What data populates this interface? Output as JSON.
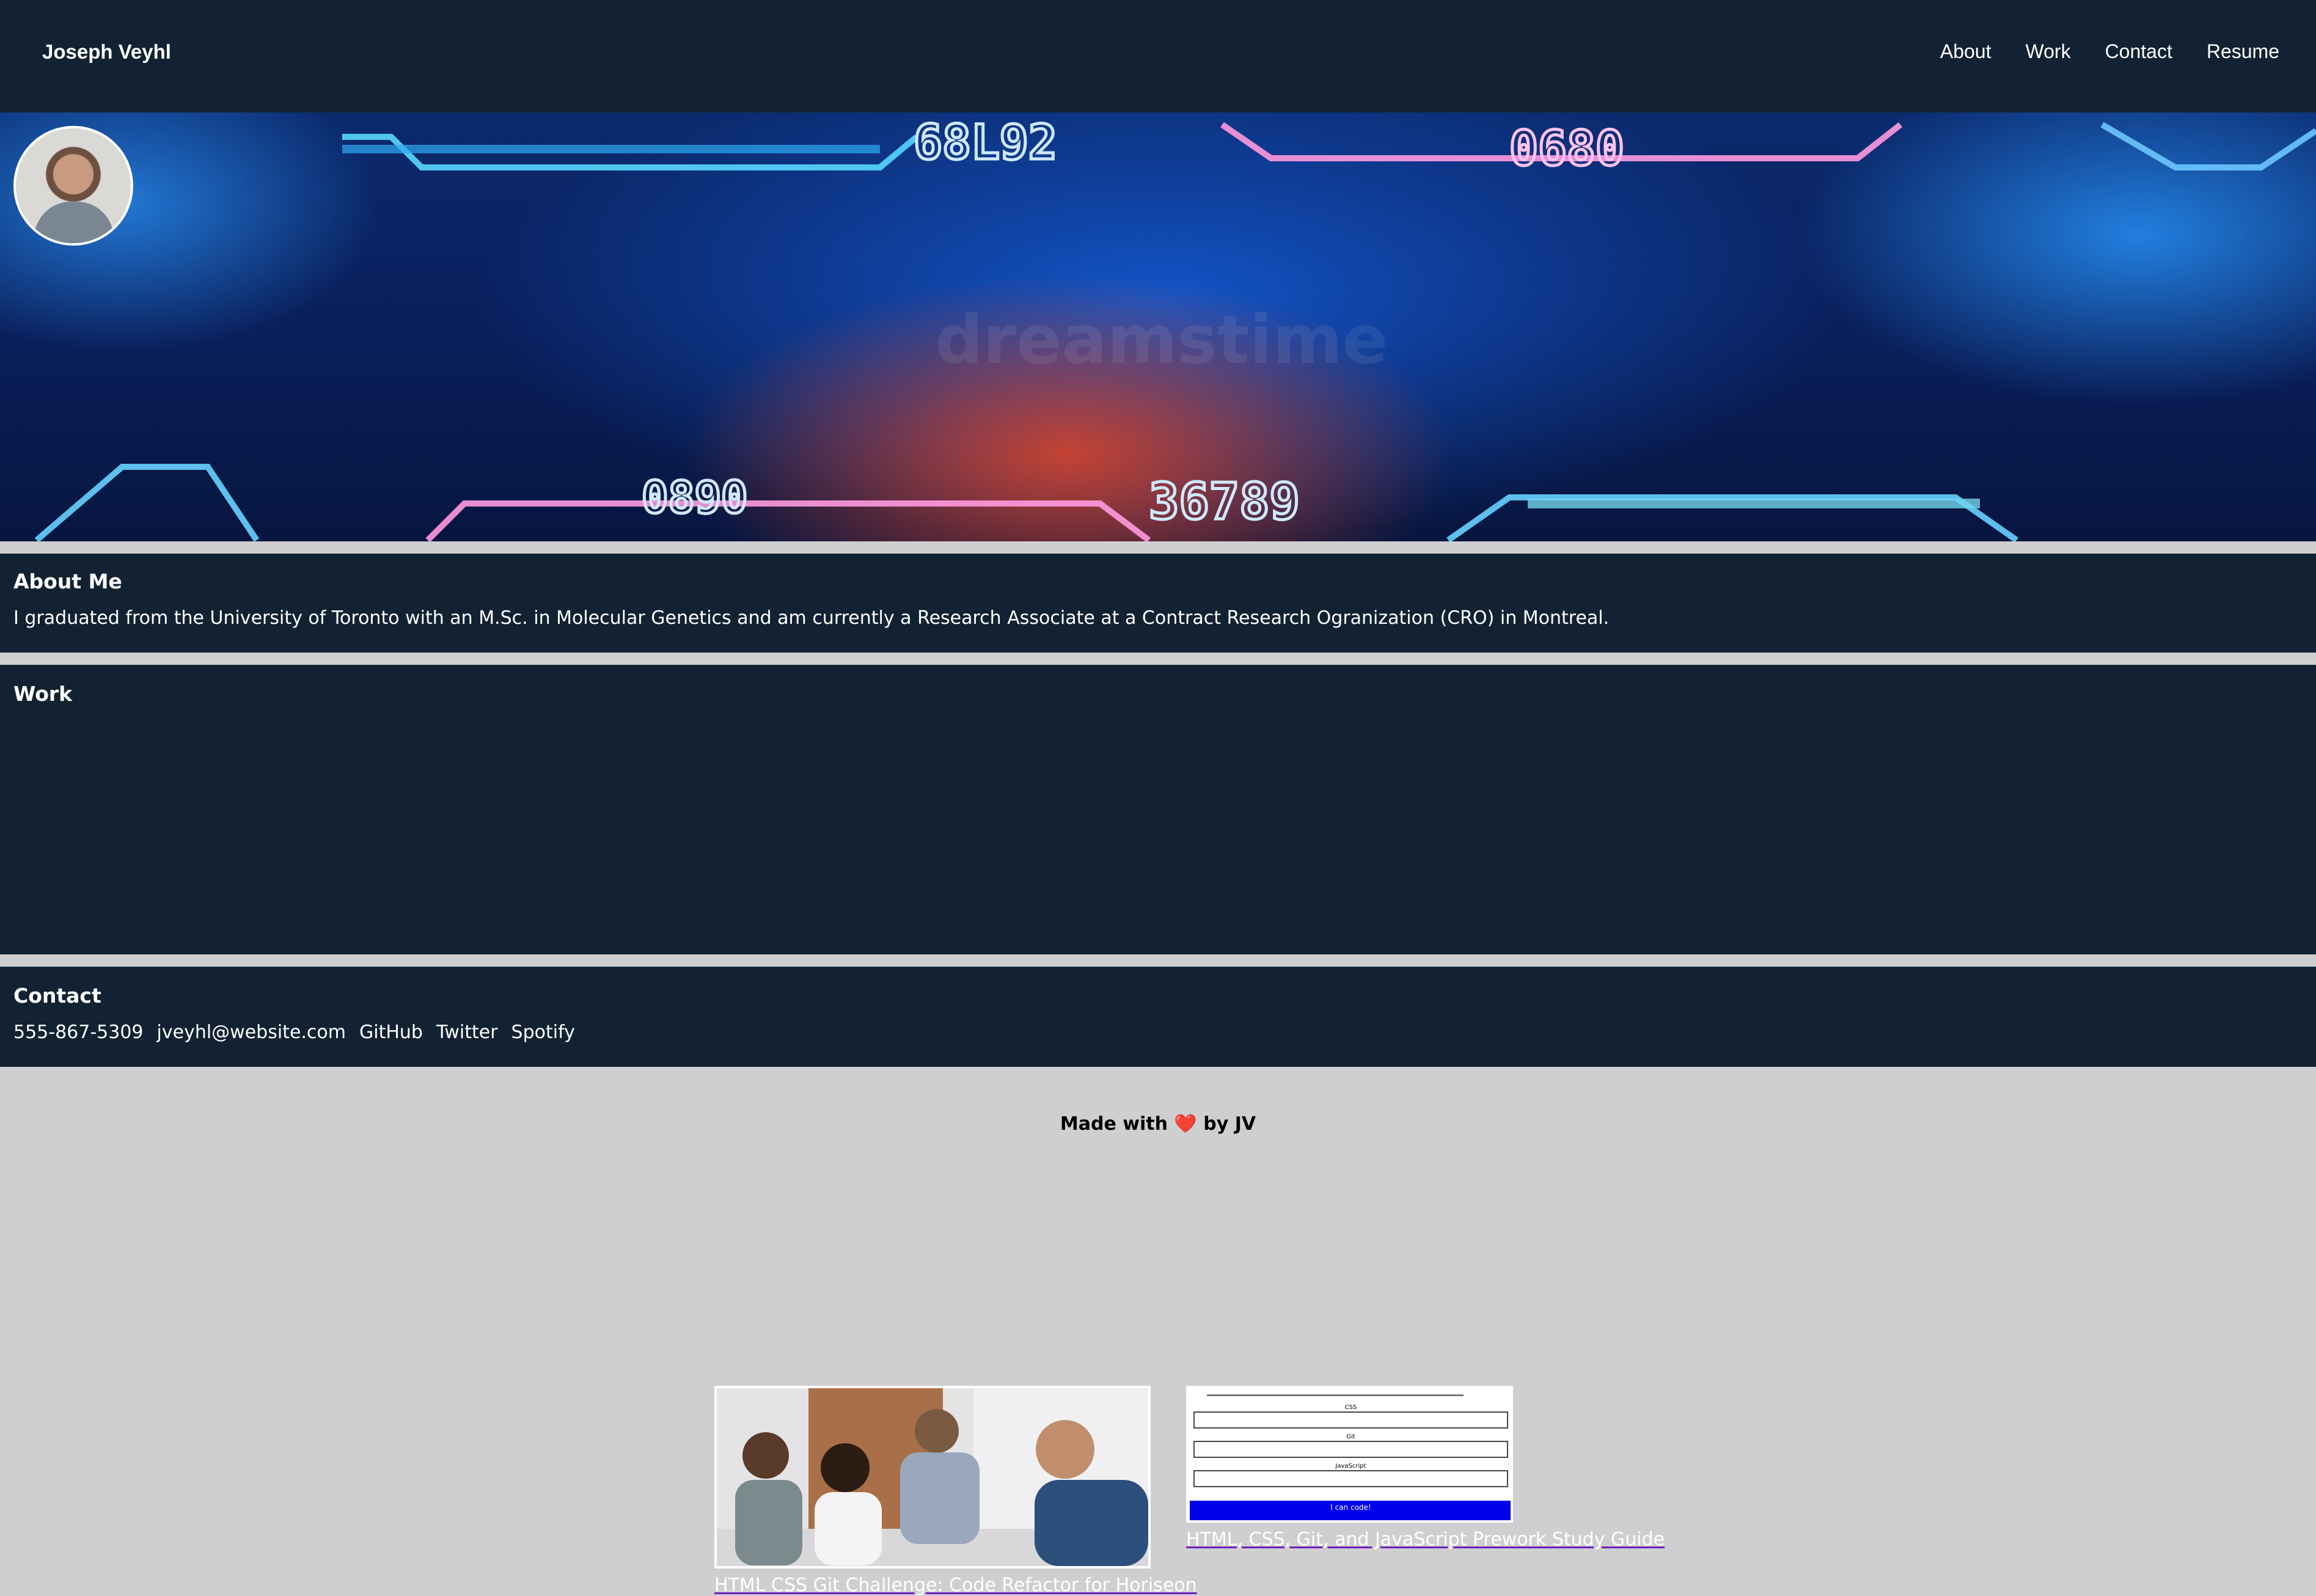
{
  "header": {
    "brand": "Joseph Veyhl",
    "nav": [
      "About",
      "Work",
      "Contact",
      "Resume"
    ]
  },
  "hero": {
    "watermark": "dreamstime",
    "digits": [
      "68L92",
      "0680",
      "0890",
      "36789"
    ]
  },
  "about": {
    "title": "About Me",
    "text": "I graduated from the University of Toronto with an M.Sc. in Molecular Genetics and am currently a Research Associate at a Contract Research Ogranization (CRO) in Montreal."
  },
  "work": {
    "title": "Work",
    "projects": [
      {
        "caption": "HTML CSS Git Challenge: Code Refactor for Horiseon"
      },
      {
        "caption": "HTML, CSS, Git, and JavaScript Prework Study Guide",
        "thumb_headings": [
          "CSS",
          "Git",
          "JavaScript"
        ],
        "thumb_footer": "I can code!"
      }
    ]
  },
  "contact": {
    "title": "Contact",
    "links": [
      "555-867-5309",
      "jveyhl@website.com",
      "GitHub",
      "Twitter",
      "Spotify"
    ]
  },
  "footer": {
    "pre": "Made with",
    "heart": "❤️",
    "post": "by JV"
  },
  "colors": {
    "dark": "#122232",
    "page_bg": "#cfcfd1",
    "link_underline": "#6e1fb8",
    "doc_bar": "#0000ee"
  }
}
